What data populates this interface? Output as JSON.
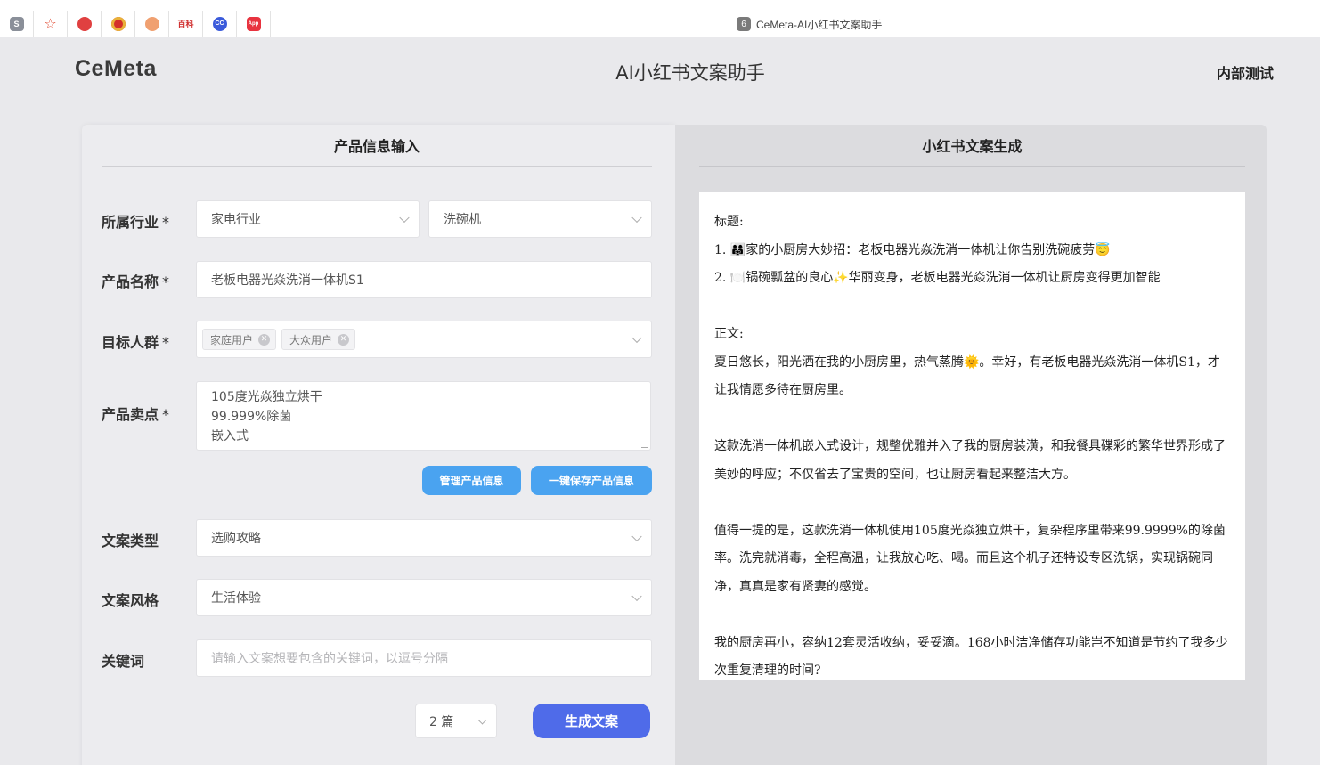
{
  "browser": {
    "tab_title": "CeMeta-AI小红书文案助手",
    "tab_badge": "6",
    "pinned_icons": [
      "sogou-icon",
      "star-icon",
      "red-icon",
      "emblem-icon",
      "orange-icon",
      "baifu-icon",
      "cc-icon",
      "red-app-icon"
    ]
  },
  "header": {
    "logo": "CeMeta",
    "title": "AI小红书文案助手",
    "badge": "内部测试"
  },
  "left_panel": {
    "title": "产品信息输入",
    "industry": {
      "label": "所属行业",
      "required": "*",
      "value1": "家电行业",
      "value2": "洗碗机"
    },
    "product_name": {
      "label": "产品名称",
      "required": "*",
      "value": "老板电器光焱洗消一体机S1"
    },
    "audience": {
      "label": "目标人群",
      "required": "*",
      "tags": [
        "家庭用户",
        "大众用户"
      ]
    },
    "selling_points": {
      "label": "产品卖点",
      "required": "*",
      "lines": [
        "105度光焱独立烘干",
        "99.999%除菌",
        "嵌入式"
      ]
    },
    "manage_button": "管理产品信息",
    "save_button": "一键保存产品信息",
    "copy_type": {
      "label": "文案类型",
      "value": "选购攻略"
    },
    "copy_style": {
      "label": "文案风格",
      "value": "生活体验"
    },
    "keywords": {
      "label": "关键词",
      "placeholder": "请输入文案想要包含的关键词，以逗号分隔"
    },
    "count": "2 篇",
    "generate_button": "生成文案"
  },
  "right_panel": {
    "title": "小红书文案生成",
    "heading_label": "标题:",
    "title1": "1. 👨‍👩‍👧家的小厨房大妙招：老板电器光焱洗消一体机让你告别洗碗疲劳😇",
    "title2": "2. 🍽️锅碗瓢盆的良心✨华丽变身，老板电器光焱洗消一体机让厨房变得更加智能",
    "body_label": "正文:",
    "para1": "夏日悠长，阳光洒在我的小厨房里，热气蒸腾🌞。幸好，有老板电器光焱洗消一体机S1，才让我情愿多待在厨房里。",
    "para2": "这款洗消一体机嵌入式设计，规整优雅并入了我的厨房装潢，和我餐具碟彩的繁华世界形成了美妙的呼应；不仅省去了宝贵的空间，也让厨房看起来整洁大方。",
    "para3": "值得一提的是，这款洗消一体机使用105度光焱独立烘干，复杂程序里带来99.9999%的除菌率。洗完就消毒，全程高温，让我放心吃、喝。而且这个机子还特设专区洗锅，实现锅碗同净，真真是家有贤妻的感觉。",
    "para4": "我的厨房再小，容纳12套灵活收纳，妥妥滴。168小时洁净储存功能岂不知道是节约了我多少次重复清理的时间?"
  }
}
